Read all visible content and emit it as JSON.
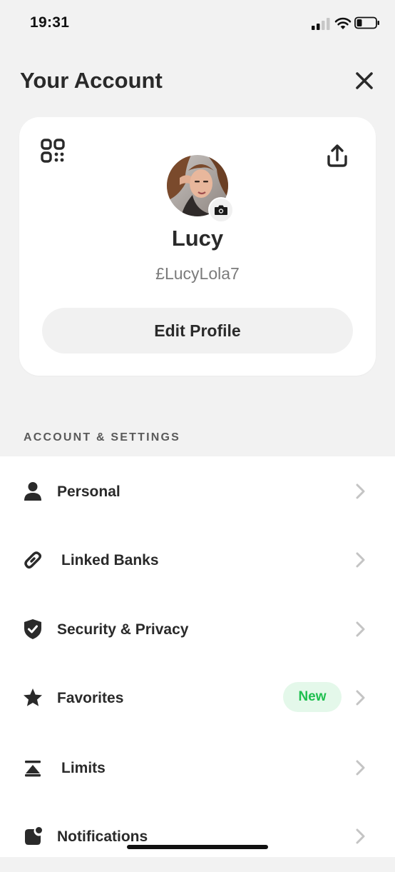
{
  "status_bar": {
    "time": "19:31"
  },
  "header": {
    "title": "Your Account",
    "close_icon": "close-icon"
  },
  "profile": {
    "name": "Lucy",
    "cashtag": "£LucyLola7",
    "edit_button_label": "Edit Profile",
    "qr_icon": "qr-code-icon",
    "share_icon": "share-icon",
    "camera_icon": "camera-icon"
  },
  "section": {
    "label": "ACCOUNT & SETTINGS"
  },
  "settings_items": [
    {
      "label": "Personal",
      "icon": "person-icon"
    },
    {
      "label": "Linked Banks",
      "icon": "link-icon"
    },
    {
      "label": "Security & Privacy",
      "icon": "shield-check-icon"
    },
    {
      "label": "Favorites",
      "icon": "star-icon",
      "badge": "New"
    },
    {
      "label": "Limits",
      "icon": "limits-icon"
    },
    {
      "label": "Notifications",
      "icon": "notification-icon"
    }
  ],
  "colors": {
    "background": "#f2f2f2",
    "card": "#ffffff",
    "badge_bg": "#e4f8ea",
    "badge_text": "#1fbf4f"
  }
}
